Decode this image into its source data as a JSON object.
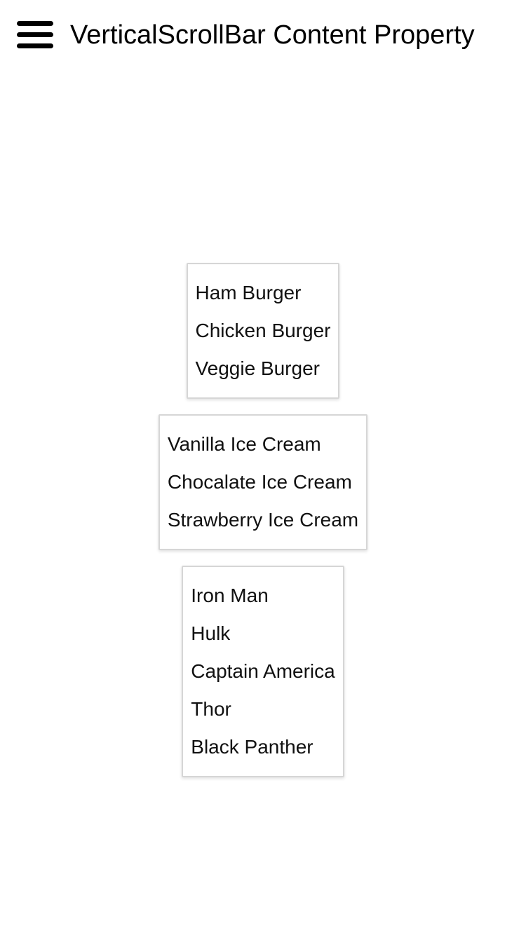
{
  "header": {
    "title": "VerticalScrollBar Content Property",
    "menu_icon": "hamburger-menu-icon"
  },
  "lists": [
    {
      "items": [
        "Ham Burger",
        "Chicken Burger",
        "Veggie Burger"
      ]
    },
    {
      "items": [
        "Vanilla Ice Cream",
        "Chocalate Ice Cream",
        "Strawberry Ice Cream"
      ]
    },
    {
      "items": [
        "Iron Man",
        "Hulk",
        "Captain America",
        "Thor",
        "Black Panther"
      ]
    }
  ]
}
